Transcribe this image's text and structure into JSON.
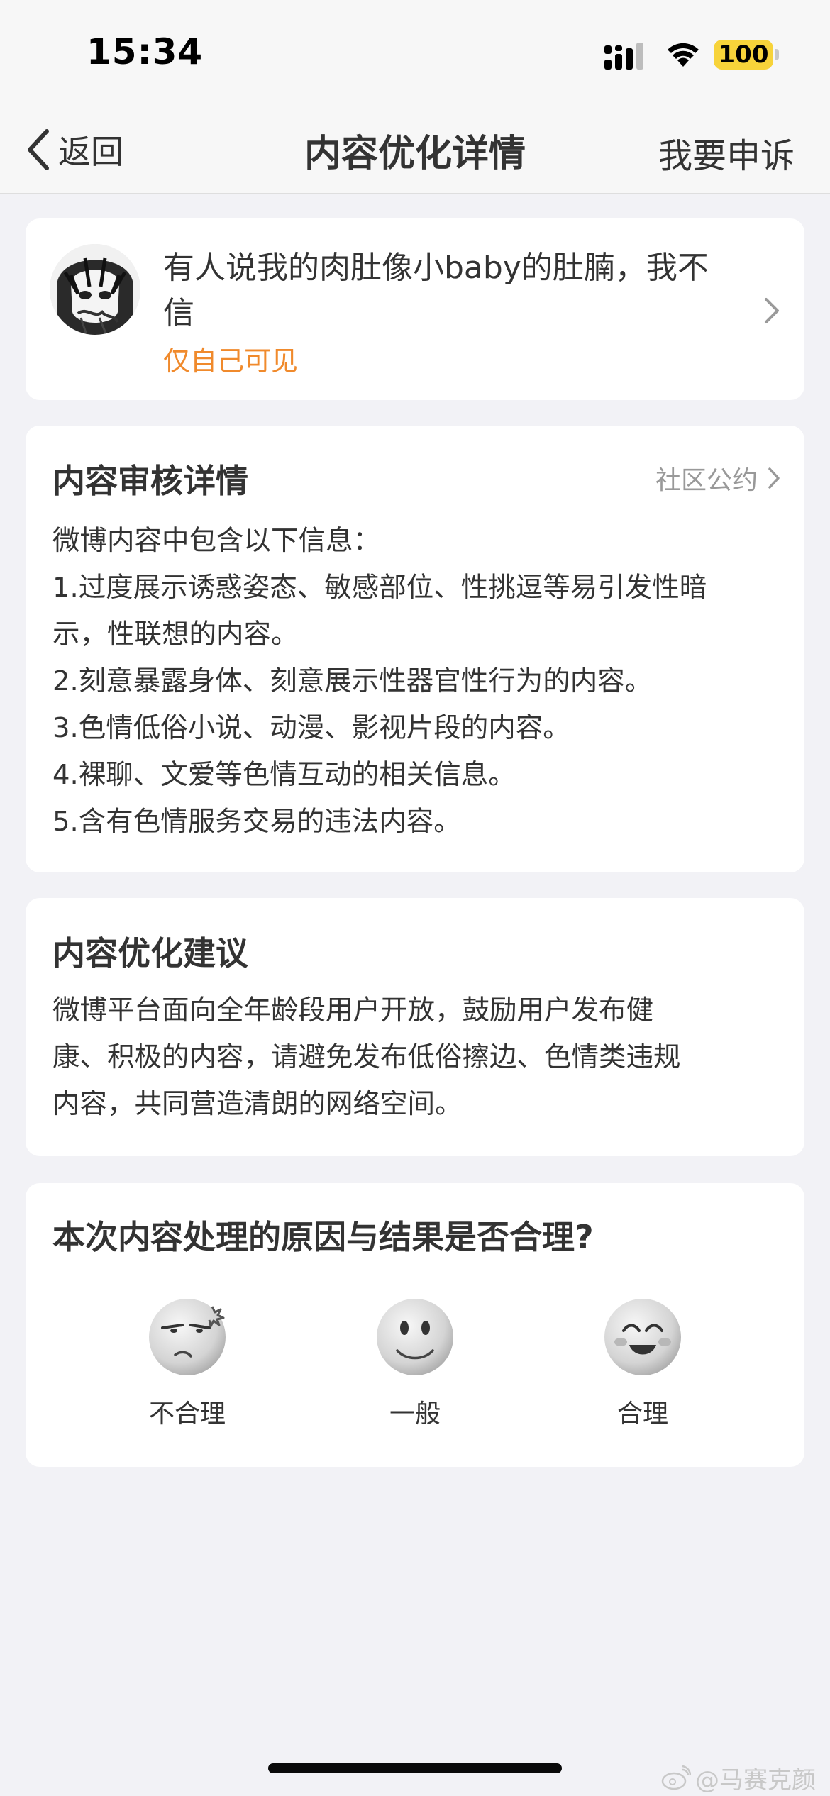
{
  "status_bar": {
    "time": "15:34",
    "battery": "100",
    "battery_color": "#f7d33a"
  },
  "nav": {
    "back_label": "返回",
    "title": "内容优化详情",
    "appeal_label": "我要申诉"
  },
  "post": {
    "text": "有人说我的肉肚像小baby的肚腩，我不信",
    "visibility": "仅自己可见",
    "visibility_color": "#f08a2c"
  },
  "review": {
    "title": "内容审核详情",
    "community_link": "社区公约",
    "lines": [
      "微博内容中包含以下信息：",
      "1.过度展示诱惑姿态、敏感部位、性挑逗等易引发性暗",
      "示，性联想的内容。",
      "2.刻意暴露身体、刻意展示性器官性行为的内容。",
      "3.色情低俗小说、动漫、影视片段的内容。",
      "4.裸聊、文爱等色情互动的相关信息。",
      "5.含有色情服务交易的违法内容。"
    ]
  },
  "advice": {
    "title": "内容优化建议",
    "lines": [
      "微博平台面向全年龄段用户开放，鼓励用户发布健",
      "康、积极的内容，请避免发布低俗擦边、色情类违规",
      "内容，共同营造清朗的网络空间。"
    ]
  },
  "feedback": {
    "question": "本次内容处理的原因与结果是否合理?",
    "options": [
      {
        "label": "不合理",
        "icon": "annoyed-face-icon"
      },
      {
        "label": "一般",
        "icon": "neutral-face-icon"
      },
      {
        "label": "合理",
        "icon": "happy-face-icon"
      }
    ]
  },
  "watermark": "@马赛克颜"
}
